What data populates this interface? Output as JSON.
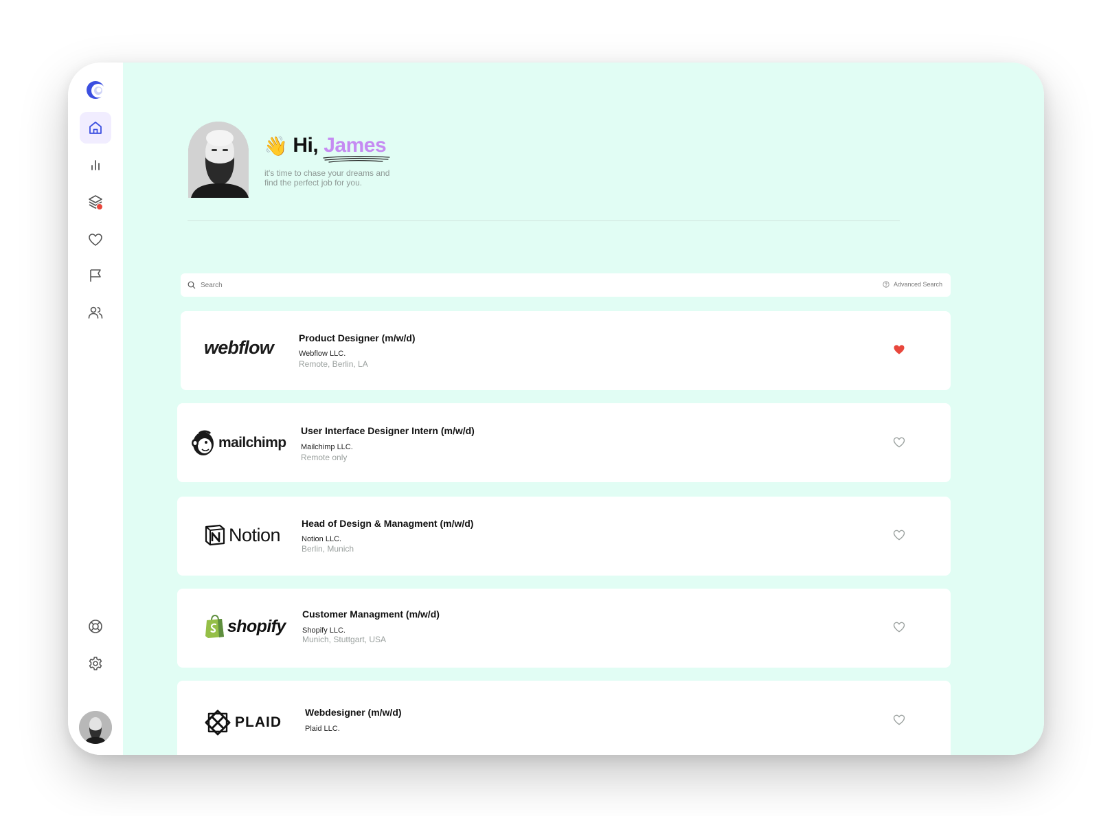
{
  "colors": {
    "accent": "#c58bf2",
    "brand_blue": "#3b4fe0",
    "background_mint": "#e1fdf4",
    "heart_active": "#e8473c",
    "heart_inactive": "#9aa09e"
  },
  "sidebar": {
    "logo_icon": "brand-logo-icon",
    "items": [
      {
        "icon": "home-icon",
        "active": true
      },
      {
        "icon": "bar-chart-icon",
        "active": false
      },
      {
        "icon": "layers-icon",
        "active": false,
        "badge": true
      },
      {
        "icon": "heart-icon",
        "active": false
      },
      {
        "icon": "flag-icon",
        "active": false
      },
      {
        "icon": "users-icon",
        "active": false
      }
    ],
    "bottom_items": [
      {
        "icon": "help-lifebuoy-icon"
      },
      {
        "icon": "settings-gear-icon"
      }
    ]
  },
  "header": {
    "wave": "👋",
    "hi": "Hi,",
    "name": "James",
    "tagline": "it's time to chase your dreams and find the perfect job for you."
  },
  "search": {
    "placeholder": "Search",
    "advanced_label": "Advanced Search"
  },
  "jobs": [
    {
      "logo": "webflow",
      "logo_text": "webflow",
      "title": "Product Designer (m/w/d)",
      "company": "Webflow LLC.",
      "location": "Remote, Berlin, LA",
      "favorited": true
    },
    {
      "logo": "mailchimp",
      "logo_text": "mailchimp",
      "title": "User Interface Designer Intern (m/w/d)",
      "company": "Mailchimp LLC.",
      "location": "Remote only",
      "favorited": false
    },
    {
      "logo": "notion",
      "logo_text": "Notion",
      "title": "Head of Design & Managment (m/w/d)",
      "company": "Notion LLC.",
      "location": "Berlin, Munich",
      "favorited": false
    },
    {
      "logo": "shopify",
      "logo_text": "shopify",
      "title": "Customer Managment (m/w/d)",
      "company": "Shopify LLC.",
      "location": "Munich, Stuttgart, USA",
      "favorited": false
    },
    {
      "logo": "plaid",
      "logo_text": "PLAID",
      "title": "Webdesigner (m/w/d)",
      "company": "Plaid LLC.",
      "location": "",
      "favorited": false
    }
  ]
}
